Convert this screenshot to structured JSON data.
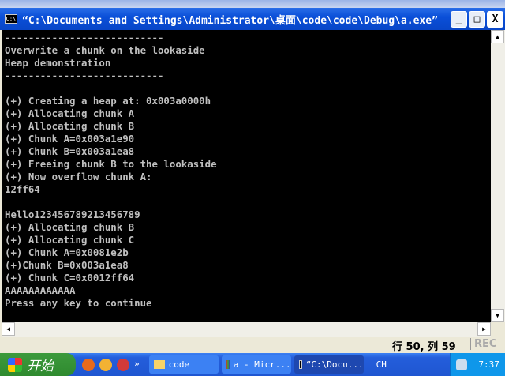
{
  "window": {
    "title": "“C:\\Documents and Settings\\Administrator\\桌面\\code\\code\\Debug\\a.exe”",
    "icon_text": "C:\\",
    "minimize": "_",
    "maximize": "□",
    "close": "X"
  },
  "console": {
    "lines": [
      "---------------------------",
      "Overwrite a chunk on the lookaside",
      "Heap demonstration",
      "---------------------------",
      "",
      "(+) Creating a heap at: 0x003a0000h",
      "(+) Allocating chunk A",
      "(+) Allocating chunk B",
      "(+) Chunk A=0x003a1e90",
      "(+) Chunk B=0x003a1ea8",
      "(+) Freeing chunk B to the lookaside",
      "(+) Now overflow chunk A:",
      "12ff64",
      "",
      "Hello123456789213456789",
      "(+) Allocating chunk B",
      "(+) Allocating chunk C",
      "(+) Chunk A=0x0081e2b",
      "(+)Chunk B=0x003a1ea8",
      "(+) Chunk C=0x0012ff64",
      "AAAAAAAAAAAA",
      "Press any key to continue"
    ]
  },
  "statusbar": {
    "position": "行 50, 列 59",
    "rec": "REC"
  },
  "taskbar": {
    "start": "开始",
    "chevron": "»",
    "tasks": [
      {
        "label": "code"
      },
      {
        "label": "a - Micr..."
      },
      {
        "label": "“C:\\Docu..."
      }
    ],
    "lang": "CH",
    "clock": "7:37"
  }
}
